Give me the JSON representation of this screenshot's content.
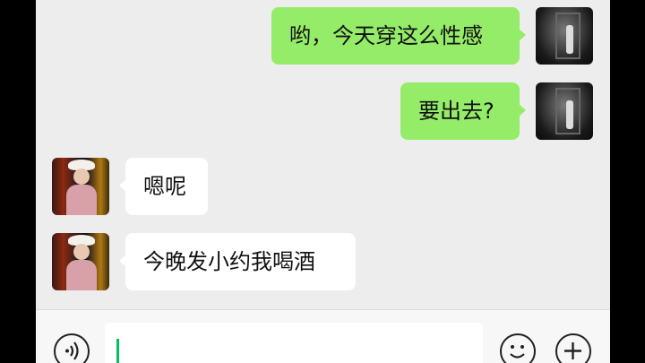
{
  "chat": {
    "messages": [
      {
        "direction": "outgoing",
        "text": "哟，今天穿这么性感"
      },
      {
        "direction": "outgoing",
        "text": "要出去?"
      },
      {
        "direction": "incoming",
        "text": "嗯呢"
      },
      {
        "direction": "incoming",
        "text": "今晚发小约我喝酒"
      }
    ]
  },
  "input_bar": {
    "value": "",
    "icons": {
      "voice": "voice-icon",
      "emoji": "emoji-icon",
      "more": "plus-icon"
    }
  },
  "colors": {
    "background": "#ededed",
    "outgoing_bubble": "#95ec69",
    "incoming_bubble": "#ffffff",
    "caret": "#07c160"
  }
}
